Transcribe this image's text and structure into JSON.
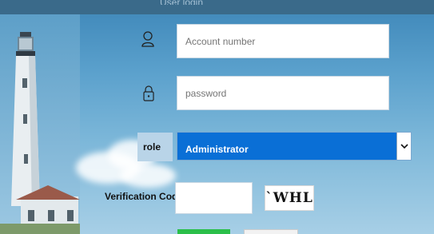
{
  "window": {
    "title": "User login"
  },
  "form": {
    "account_placeholder": "Account number",
    "password_placeholder": "password",
    "role_label": "role",
    "role_selected": "Administrator",
    "verification_label": "Verification Code",
    "verification_value": "",
    "captcha_text": "`WHL N"
  },
  "icons": {
    "user": "user-icon",
    "lock": "lock-icon",
    "dropdown": "chevron-down-icon"
  },
  "colors": {
    "select_highlight": "#0a6fd6",
    "login_button": "#2bbf4a"
  }
}
